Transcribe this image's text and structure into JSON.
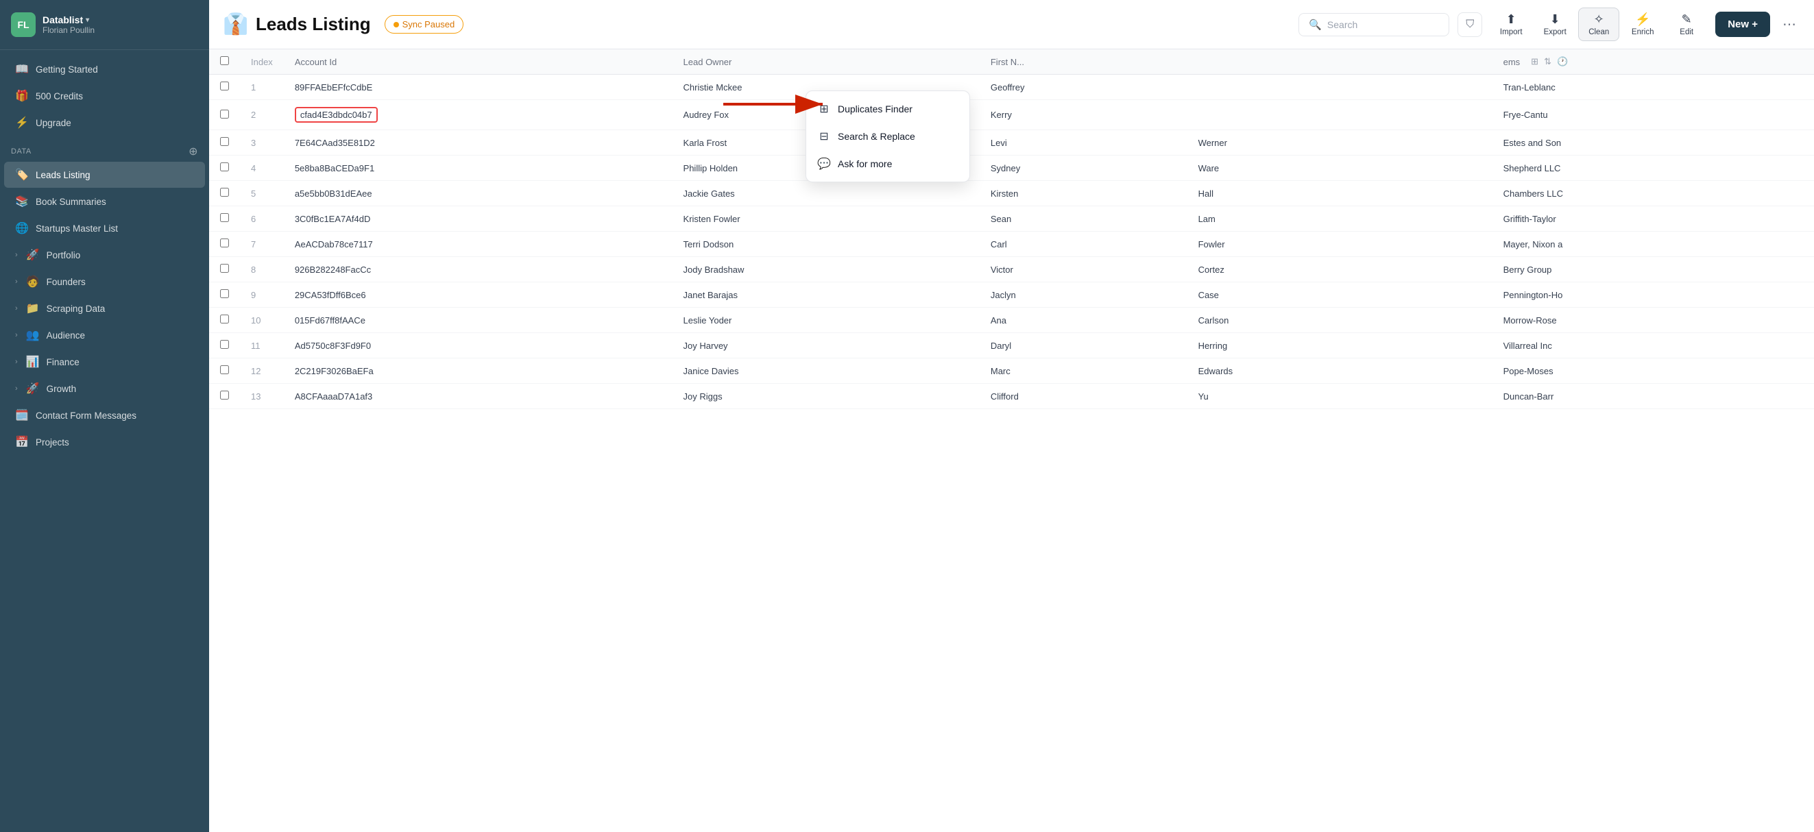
{
  "sidebar": {
    "avatar_initials": "FL",
    "org_name": "Datablist",
    "org_user": "Florian Poullin",
    "nav_items": [
      {
        "id": "getting-started",
        "label": "Getting Started",
        "icon": "📖",
        "expandable": false
      },
      {
        "id": "credits",
        "label": "500 Credits",
        "icon": "🎁",
        "expandable": false
      },
      {
        "id": "upgrade",
        "label": "Upgrade",
        "icon": "⚡",
        "expandable": false
      }
    ],
    "section_label": "Data",
    "data_items": [
      {
        "id": "leads-listing",
        "label": "Leads Listing",
        "icon": "🏷️",
        "active": true,
        "expandable": false
      },
      {
        "id": "book-summaries",
        "label": "Book Summaries",
        "icon": "📚",
        "expandable": false
      },
      {
        "id": "startups-master",
        "label": "Startups Master List",
        "icon": "🌐",
        "expandable": false
      },
      {
        "id": "portfolio",
        "label": "Portfolio",
        "icon": "🚀",
        "expandable": true
      },
      {
        "id": "founders",
        "label": "Founders",
        "icon": "🧑",
        "expandable": true
      },
      {
        "id": "scraping-data",
        "label": "Scraping Data",
        "icon": "📁",
        "expandable": true
      },
      {
        "id": "audience",
        "label": "Audience",
        "icon": "👥",
        "expandable": true
      },
      {
        "id": "finance",
        "label": "Finance",
        "icon": "📊",
        "expandable": true
      },
      {
        "id": "growth",
        "label": "Growth",
        "icon": "🚀",
        "expandable": true
      },
      {
        "id": "contact-form",
        "label": "Contact Form Messages",
        "icon": "🗓️",
        "expandable": false
      },
      {
        "id": "projects",
        "label": "Projects",
        "icon": "📅",
        "expandable": false
      }
    ]
  },
  "header": {
    "logo_emoji": "👔",
    "title": "Leads Listing",
    "sync_status": "Sync Paused",
    "search_placeholder": "Search",
    "toolbar": {
      "import_label": "Import",
      "export_label": "Export",
      "clean_label": "Clean",
      "enrich_label": "Enrich",
      "edit_label": "Edit"
    },
    "new_button": "New +",
    "items_count": "items"
  },
  "dropdown": {
    "items": [
      {
        "id": "duplicates-finder",
        "label": "Duplicates Finder",
        "icon": "⊞"
      },
      {
        "id": "search-replace",
        "label": "Search & Replace",
        "icon": "⊟"
      },
      {
        "id": "ask-for-more",
        "label": "Ask for more",
        "icon": "💬"
      }
    ]
  },
  "table": {
    "columns": [
      "Index",
      "Account Id",
      "Lead Owner",
      "First N...",
      "",
      "ems"
    ],
    "rows": [
      {
        "index": 1,
        "account_id": "89FFAEbEFfcCdbE",
        "lead_owner": "Christie Mckee",
        "first_name": "Geoffrey",
        "last_name": "",
        "company": "Tran-Leblanc"
      },
      {
        "index": 2,
        "account_id": "cfad4E3dbdc04b7",
        "lead_owner": "Audrey Fox",
        "first_name": "Kerry",
        "last_name": "",
        "company": "Frye-Cantu",
        "highlighted": true
      },
      {
        "index": 3,
        "account_id": "7E64CAad35E81D2",
        "lead_owner": "Karla Frost",
        "first_name": "Levi",
        "last_name": "Werner",
        "company": "Estes and Son"
      },
      {
        "index": 4,
        "account_id": "5e8ba8BaCEDa9F1",
        "lead_owner": "Phillip Holden",
        "first_name": "Sydney",
        "last_name": "Ware",
        "company": "Shepherd LLC"
      },
      {
        "index": 5,
        "account_id": "a5e5bb0B31dEAee",
        "lead_owner": "Jackie Gates",
        "first_name": "Kirsten",
        "last_name": "Hall",
        "company": "Chambers LLC"
      },
      {
        "index": 6,
        "account_id": "3C0fBc1EA7Af4dD",
        "lead_owner": "Kristen Fowler",
        "first_name": "Sean",
        "last_name": "Lam",
        "company": "Griffith-Taylor"
      },
      {
        "index": 7,
        "account_id": "AeACDab78ce7117",
        "lead_owner": "Terri Dodson",
        "first_name": "Carl",
        "last_name": "Fowler",
        "company": "Mayer, Nixon a"
      },
      {
        "index": 8,
        "account_id": "926B282248FacCc",
        "lead_owner": "Jody Bradshaw",
        "first_name": "Victor",
        "last_name": "Cortez",
        "company": "Berry Group"
      },
      {
        "index": 9,
        "account_id": "29CA53fDff6Bce6",
        "lead_owner": "Janet Barajas",
        "first_name": "Jaclyn",
        "last_name": "Case",
        "company": "Pennington-Ho"
      },
      {
        "index": 10,
        "account_id": "015Fd67ff8fAACe",
        "lead_owner": "Leslie Yoder",
        "first_name": "Ana",
        "last_name": "Carlson",
        "company": "Morrow-Rose"
      },
      {
        "index": 11,
        "account_id": "Ad5750c8F3Fd9F0",
        "lead_owner": "Joy Harvey",
        "first_name": "Daryl",
        "last_name": "Herring",
        "company": "Villarreal Inc"
      },
      {
        "index": 12,
        "account_id": "2C219F3026BaEFa",
        "lead_owner": "Janice Davies",
        "first_name": "Marc",
        "last_name": "Edwards",
        "company": "Pope-Moses"
      },
      {
        "index": 13,
        "account_id": "A8CFAaaaD7A1af3",
        "lead_owner": "Joy Riggs",
        "first_name": "Clifford",
        "last_name": "Yu",
        "company": "Duncan-Barr"
      }
    ]
  }
}
